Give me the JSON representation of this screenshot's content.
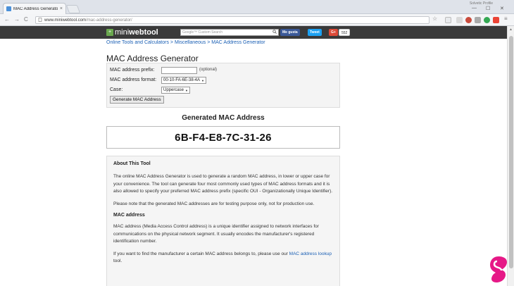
{
  "browser": {
    "tab_title": "MAC Address Generator",
    "tab_close": "×",
    "user_label": "Solvetic Profile",
    "url_host": "www.miniwebtool.com",
    "url_path": "/mac-address-generator/",
    "win_min": "—",
    "win_max": "☐",
    "win_close": "✕",
    "back": "←",
    "forward": "→",
    "reload": "C",
    "star": "☆",
    "menu": "≡"
  },
  "site": {
    "logo_prefix": "mini",
    "logo_suffix": "webtool",
    "search_placeholder": "Google™ Custom Search",
    "like_label": "Me gusta",
    "tweet_label": "Tweet",
    "gplus_label": "G+",
    "share_count": "552"
  },
  "breadcrumb": {
    "text": "Online Tools and Calculators > Miscellaneous > MAC Address Generator"
  },
  "page": {
    "title": "MAC Address Generator"
  },
  "form": {
    "prefix_label": "MAC address prefix:",
    "prefix_value": "",
    "optional_note": "(optional)",
    "format_label": "MAC address format:",
    "format_value": "00-10-FA-6E-38-4A",
    "case_label": "Case:",
    "case_value": "Uppercase",
    "generate_button": "Generate MAC Address"
  },
  "result": {
    "label": "Generated MAC Address",
    "value": "6B-F4-E8-7C-31-26"
  },
  "about": {
    "heading": "About This Tool",
    "p1": "The online MAC Address Generator is used to generate a random MAC address, in lower or upper case for your convenience. The tool can generate four most commonly used types of MAC address formats and it is also allowed to specify your preferred MAC address prefix (specific OUI - Organizationally Unique Identifier).",
    "p2": "Please note that the generated MAC addresses are for testing purpose only, not for production use.",
    "subheading": "MAC address",
    "p3": "MAC address (Media Access Control address) is a unique identifier assigned to network interfaces for communications on the physical network segment. It usually encodes the manufacturer's registered identification number.",
    "p4_text": "If you want to find the manufacturer a certain MAC address belongs to, please use our ",
    "p4_link": "MAC address lookup",
    "p4_end": " tool."
  },
  "icons": {
    "lock": "lock-icon",
    "search": "search-icon"
  },
  "colors": {
    "header_bg": "#3a3a3a",
    "link": "#1a5fb4",
    "logo_green": "#6aa84f",
    "facebook": "#3b5998",
    "twitter": "#1da1f2",
    "gplus": "#dd4b39"
  }
}
